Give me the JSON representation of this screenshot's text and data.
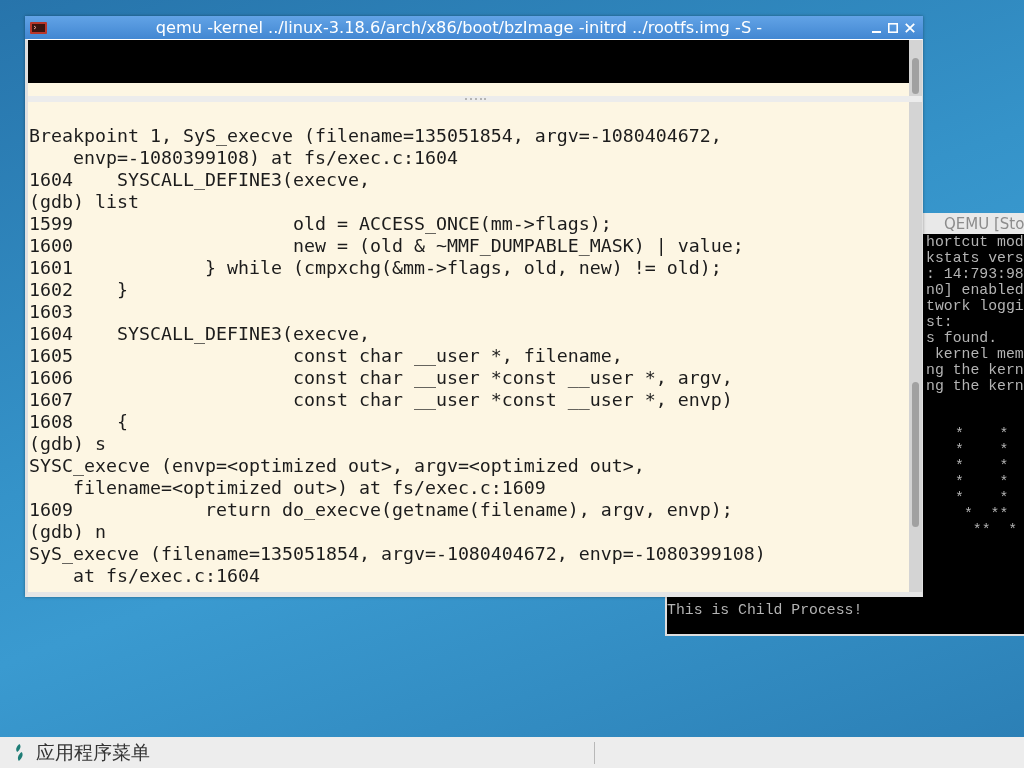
{
  "terminal_window": {
    "title": "qemu -kernel ../linux-3.18.6/arch/x86/boot/bzImage -initrd ../rootfs.img -S -",
    "output_lines": [
      "Breakpoint 1, SyS_execve (filename=135051854, argv=-1080404672,",
      "    envp=-1080399108) at fs/exec.c:1604",
      "1604    SYSCALL_DEFINE3(execve,",
      "(gdb) list",
      "1599                    old = ACCESS_ONCE(mm->flags);",
      "1600                    new = (old & ~MMF_DUMPABLE_MASK) | value;",
      "1601            } while (cmpxchg(&mm->flags, old, new) != old);",
      "1602    }",
      "1603",
      "1604    SYSCALL_DEFINE3(execve,",
      "1605                    const char __user *, filename,",
      "1606                    const char __user *const __user *, argv,",
      "1607                    const char __user *const __user *, envp)",
      "1608    {",
      "(gdb) s",
      "SYSC_execve (envp=<optimized out>, argv=<optimized out>,",
      "    filename=<optimized out>) at fs/exec.c:1609",
      "1609            return do_execve(getname(filename), argv, envp);",
      "(gdb) n",
      "SyS_execve (filename=135051854, argv=-1080404672, envp=-1080399108)",
      "    at fs/exec.c:1604"
    ]
  },
  "qemu_window": {
    "title": "QEMU [Sto",
    "console_lines": [
      "hortcut mod",
      "kstats vers",
      ": 14:793:98",
      "n0] enabled",
      "twork loggi",
      "st:",
      "s found.",
      " kernel mem",
      "ng the kern",
      "ng the kern"
    ],
    "ascii_art": "*    *\n*    *\n*    *\n*    *\n*    *\n *  **\n  **  *",
    "process_output": [
      "This is Child Process!"
    ]
  },
  "taskbar": {
    "menu_label": "应用程序菜单"
  }
}
